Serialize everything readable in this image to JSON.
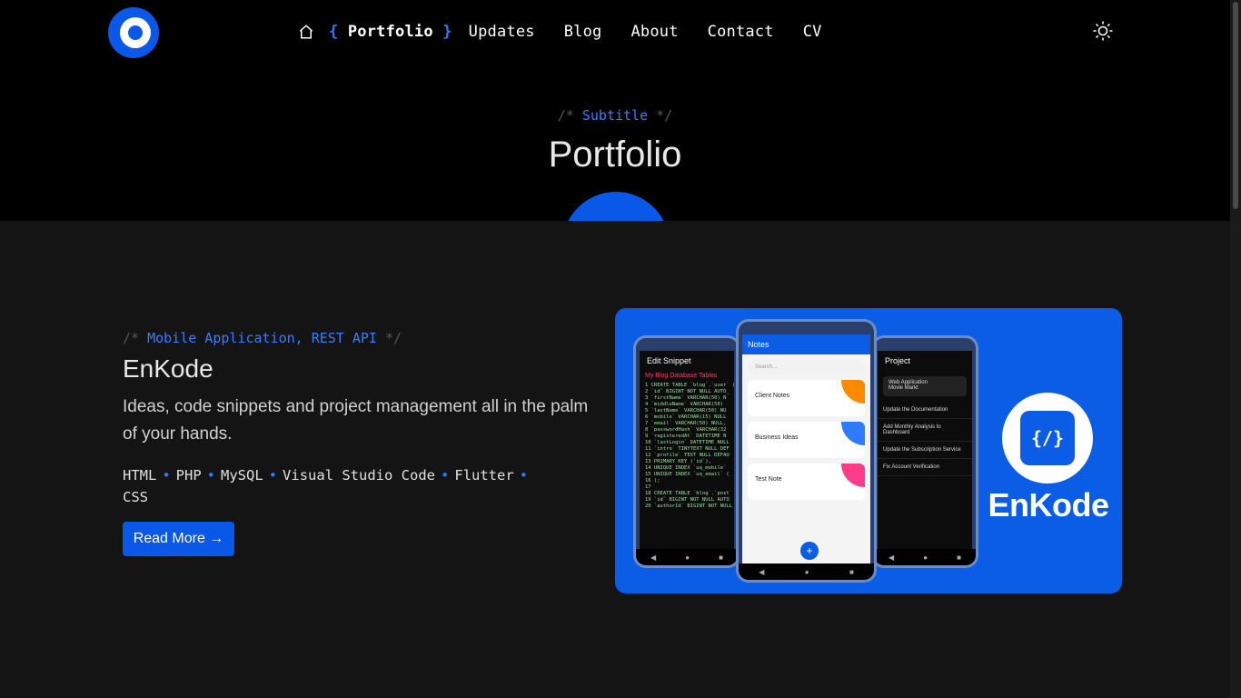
{
  "nav": {
    "items": [
      {
        "label": "Portfolio",
        "active": true
      },
      {
        "label": "Updates"
      },
      {
        "label": "Blog"
      },
      {
        "label": "About"
      },
      {
        "label": "Contact"
      },
      {
        "label": "CV"
      }
    ],
    "brace_open": "{",
    "brace_close": "}"
  },
  "hero": {
    "comment_open": "/*",
    "subtitle": "Subtitle",
    "comment_close": "*/",
    "title": "Portfolio"
  },
  "project": {
    "comment_open": "/*",
    "tags": "Mobile Application, REST API",
    "comment_close": "*/",
    "title": "EnKode",
    "description": "Ideas, code snippets and project management all in the palm of your hands.",
    "tech": [
      "HTML",
      "PHP",
      "MySQL",
      "Visual Studio Code",
      "Flutter",
      "CSS"
    ],
    "separator": "•",
    "read_more": "Read More →"
  },
  "showcase": {
    "app_name": "EnKode",
    "app_icon": "{/}",
    "left_phone": {
      "title": "Edit Snippet",
      "heading": "My Blog Database Tables",
      "code": [
        "1  CREATE TABLE `blog`.`user` (",
        "2    `id` BIGINT NOT NULL AUTO_",
        "3    `firstName` VARCHAR(50) N",
        "4    `middleName` VARCHAR(50)",
        "5    `lastName` VARCHAR(50) NU",
        "6    `mobile` VARCHAR(15) NULL",
        "7    `email` VARCHAR(50) NULL,",
        "8    `passwordHash` VARCHAR(32",
        "9    `registeredAt` DATETIME N",
        "10   `lastLogin` DATETIME NULL",
        "11   `intro` TINYTEXT NULL DEF",
        "12   `profile` TEXT NULL DEFAU",
        "13   PRIMARY KEY (`id`),",
        "14   UNIQUE INDEX `uq_mobile`",
        "15   UNIQUE INDEX `uq_email` (",
        "16 );",
        "17",
        "18 CREATE TABLE `blog`.`post` (",
        "19   `id` BIGINT NOT NULL AUTO",
        "20   `authorId` BIGINT NOT NULL"
      ]
    },
    "mid_phone": {
      "title": "Notes",
      "search": "Search...",
      "notes": [
        {
          "title": "Client Notes",
          "color": "#ff8a00"
        },
        {
          "title": "Business Ideas",
          "color": "#2f7bff"
        },
        {
          "title": "Test Note",
          "color": "#ff3b8a"
        }
      ],
      "fab": "+"
    },
    "right_phone": {
      "title": "Project",
      "card_label": "Web Application",
      "card_value": "Movie Markt",
      "tasks": [
        "Update the Documentation",
        "Add Monthly Analysis to Dashboard",
        "Update the Subscription Service",
        "Fix Account Verification"
      ]
    }
  }
}
